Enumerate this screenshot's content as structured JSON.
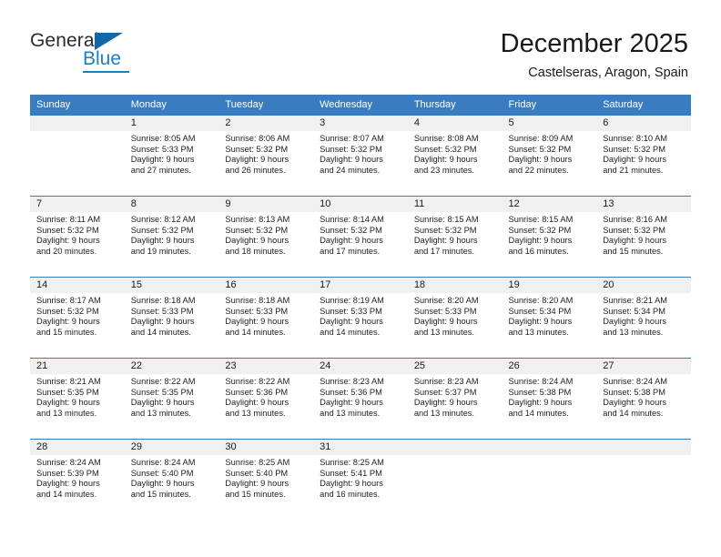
{
  "brand": {
    "word_general": "General",
    "word_blue": "Blue",
    "logo_icon": "flag-triangle-icon"
  },
  "header": {
    "title": "December 2025",
    "subtitle": "Castelseras, Aragon, Spain"
  },
  "colors": {
    "header_blue": "#3a7cc0",
    "brand_blue": "#1b7fc4",
    "daynum_bg": "#f0f0f0",
    "text": "#1a1a1a"
  },
  "weekdays": [
    "Sunday",
    "Monday",
    "Tuesday",
    "Wednesday",
    "Thursday",
    "Friday",
    "Saturday"
  ],
  "weeks": [
    [
      {
        "day": "",
        "sunrise": "",
        "sunset": "",
        "daylight1": "",
        "daylight2": ""
      },
      {
        "day": "1",
        "sunrise": "Sunrise: 8:05 AM",
        "sunset": "Sunset: 5:33 PM",
        "daylight1": "Daylight: 9 hours",
        "daylight2": "and 27 minutes."
      },
      {
        "day": "2",
        "sunrise": "Sunrise: 8:06 AM",
        "sunset": "Sunset: 5:32 PM",
        "daylight1": "Daylight: 9 hours",
        "daylight2": "and 26 minutes."
      },
      {
        "day": "3",
        "sunrise": "Sunrise: 8:07 AM",
        "sunset": "Sunset: 5:32 PM",
        "daylight1": "Daylight: 9 hours",
        "daylight2": "and 24 minutes."
      },
      {
        "day": "4",
        "sunrise": "Sunrise: 8:08 AM",
        "sunset": "Sunset: 5:32 PM",
        "daylight1": "Daylight: 9 hours",
        "daylight2": "and 23 minutes."
      },
      {
        "day": "5",
        "sunrise": "Sunrise: 8:09 AM",
        "sunset": "Sunset: 5:32 PM",
        "daylight1": "Daylight: 9 hours",
        "daylight2": "and 22 minutes."
      },
      {
        "day": "6",
        "sunrise": "Sunrise: 8:10 AM",
        "sunset": "Sunset: 5:32 PM",
        "daylight1": "Daylight: 9 hours",
        "daylight2": "and 21 minutes."
      }
    ],
    [
      {
        "day": "7",
        "sunrise": "Sunrise: 8:11 AM",
        "sunset": "Sunset: 5:32 PM",
        "daylight1": "Daylight: 9 hours",
        "daylight2": "and 20 minutes."
      },
      {
        "day": "8",
        "sunrise": "Sunrise: 8:12 AM",
        "sunset": "Sunset: 5:32 PM",
        "daylight1": "Daylight: 9 hours",
        "daylight2": "and 19 minutes."
      },
      {
        "day": "9",
        "sunrise": "Sunrise: 8:13 AM",
        "sunset": "Sunset: 5:32 PM",
        "daylight1": "Daylight: 9 hours",
        "daylight2": "and 18 minutes."
      },
      {
        "day": "10",
        "sunrise": "Sunrise: 8:14 AM",
        "sunset": "Sunset: 5:32 PM",
        "daylight1": "Daylight: 9 hours",
        "daylight2": "and 17 minutes."
      },
      {
        "day": "11",
        "sunrise": "Sunrise: 8:15 AM",
        "sunset": "Sunset: 5:32 PM",
        "daylight1": "Daylight: 9 hours",
        "daylight2": "and 17 minutes."
      },
      {
        "day": "12",
        "sunrise": "Sunrise: 8:15 AM",
        "sunset": "Sunset: 5:32 PM",
        "daylight1": "Daylight: 9 hours",
        "daylight2": "and 16 minutes."
      },
      {
        "day": "13",
        "sunrise": "Sunrise: 8:16 AM",
        "sunset": "Sunset: 5:32 PM",
        "daylight1": "Daylight: 9 hours",
        "daylight2": "and 15 minutes."
      }
    ],
    [
      {
        "day": "14",
        "sunrise": "Sunrise: 8:17 AM",
        "sunset": "Sunset: 5:32 PM",
        "daylight1": "Daylight: 9 hours",
        "daylight2": "and 15 minutes."
      },
      {
        "day": "15",
        "sunrise": "Sunrise: 8:18 AM",
        "sunset": "Sunset: 5:33 PM",
        "daylight1": "Daylight: 9 hours",
        "daylight2": "and 14 minutes."
      },
      {
        "day": "16",
        "sunrise": "Sunrise: 8:18 AM",
        "sunset": "Sunset: 5:33 PM",
        "daylight1": "Daylight: 9 hours",
        "daylight2": "and 14 minutes."
      },
      {
        "day": "17",
        "sunrise": "Sunrise: 8:19 AM",
        "sunset": "Sunset: 5:33 PM",
        "daylight1": "Daylight: 9 hours",
        "daylight2": "and 14 minutes."
      },
      {
        "day": "18",
        "sunrise": "Sunrise: 8:20 AM",
        "sunset": "Sunset: 5:33 PM",
        "daylight1": "Daylight: 9 hours",
        "daylight2": "and 13 minutes."
      },
      {
        "day": "19",
        "sunrise": "Sunrise: 8:20 AM",
        "sunset": "Sunset: 5:34 PM",
        "daylight1": "Daylight: 9 hours",
        "daylight2": "and 13 minutes."
      },
      {
        "day": "20",
        "sunrise": "Sunrise: 8:21 AM",
        "sunset": "Sunset: 5:34 PM",
        "daylight1": "Daylight: 9 hours",
        "daylight2": "and 13 minutes."
      }
    ],
    [
      {
        "day": "21",
        "sunrise": "Sunrise: 8:21 AM",
        "sunset": "Sunset: 5:35 PM",
        "daylight1": "Daylight: 9 hours",
        "daylight2": "and 13 minutes."
      },
      {
        "day": "22",
        "sunrise": "Sunrise: 8:22 AM",
        "sunset": "Sunset: 5:35 PM",
        "daylight1": "Daylight: 9 hours",
        "daylight2": "and 13 minutes."
      },
      {
        "day": "23",
        "sunrise": "Sunrise: 8:22 AM",
        "sunset": "Sunset: 5:36 PM",
        "daylight1": "Daylight: 9 hours",
        "daylight2": "and 13 minutes."
      },
      {
        "day": "24",
        "sunrise": "Sunrise: 8:23 AM",
        "sunset": "Sunset: 5:36 PM",
        "daylight1": "Daylight: 9 hours",
        "daylight2": "and 13 minutes."
      },
      {
        "day": "25",
        "sunrise": "Sunrise: 8:23 AM",
        "sunset": "Sunset: 5:37 PM",
        "daylight1": "Daylight: 9 hours",
        "daylight2": "and 13 minutes."
      },
      {
        "day": "26",
        "sunrise": "Sunrise: 8:24 AM",
        "sunset": "Sunset: 5:38 PM",
        "daylight1": "Daylight: 9 hours",
        "daylight2": "and 14 minutes."
      },
      {
        "day": "27",
        "sunrise": "Sunrise: 8:24 AM",
        "sunset": "Sunset: 5:38 PM",
        "daylight1": "Daylight: 9 hours",
        "daylight2": "and 14 minutes."
      }
    ],
    [
      {
        "day": "28",
        "sunrise": "Sunrise: 8:24 AM",
        "sunset": "Sunset: 5:39 PM",
        "daylight1": "Daylight: 9 hours",
        "daylight2": "and 14 minutes."
      },
      {
        "day": "29",
        "sunrise": "Sunrise: 8:24 AM",
        "sunset": "Sunset: 5:40 PM",
        "daylight1": "Daylight: 9 hours",
        "daylight2": "and 15 minutes."
      },
      {
        "day": "30",
        "sunrise": "Sunrise: 8:25 AM",
        "sunset": "Sunset: 5:40 PM",
        "daylight1": "Daylight: 9 hours",
        "daylight2": "and 15 minutes."
      },
      {
        "day": "31",
        "sunrise": "Sunrise: 8:25 AM",
        "sunset": "Sunset: 5:41 PM",
        "daylight1": "Daylight: 9 hours",
        "daylight2": "and 16 minutes."
      },
      {
        "day": "",
        "sunrise": "",
        "sunset": "",
        "daylight1": "",
        "daylight2": ""
      },
      {
        "day": "",
        "sunrise": "",
        "sunset": "",
        "daylight1": "",
        "daylight2": ""
      },
      {
        "day": "",
        "sunrise": "",
        "sunset": "",
        "daylight1": "",
        "daylight2": ""
      }
    ]
  ]
}
